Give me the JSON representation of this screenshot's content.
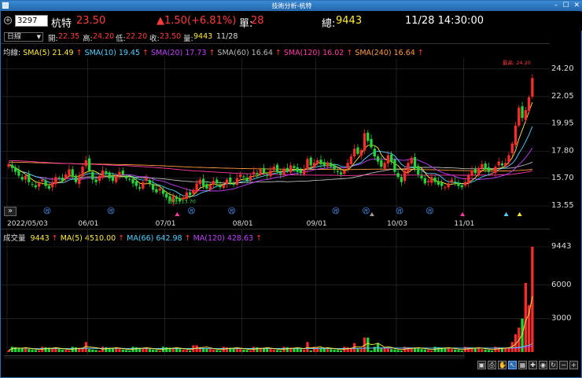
{
  "window": {
    "title": "技術分析-杭特"
  },
  "quote": {
    "code": "3297",
    "name": "杭特",
    "price": "23.50",
    "change": "▲1.50(+6.81%)",
    "single_label": "單:",
    "single_value": "28",
    "total_label": "總:",
    "total_value": "9443",
    "datetime": "11/28 14:30:00"
  },
  "ohlc": {
    "period": "日線",
    "open_label": "開:",
    "open": "22.35",
    "high_label": "高:",
    "high": "24.20",
    "low_label": "低:",
    "low": "22.20",
    "close_label": "收:",
    "close": "23.50",
    "volume_label": "量:",
    "volume": "9443",
    "date": "11/28"
  },
  "price_legend": {
    "prefix": "均線:",
    "items": [
      {
        "text": "SMA(5) 21.49",
        "color": "#ffeb3b"
      },
      {
        "text": "SMA(10) 19.45",
        "color": "#4fd1ff"
      },
      {
        "text": "SMA(20) 17.73",
        "color": "#c040ff"
      },
      {
        "text": "SMA(60) 16.64",
        "color": "#bbbbbb"
      },
      {
        "text": "SMA(120) 16.02",
        "color": "#ff3aa5"
      },
      {
        "text": "SMA(240) 16.64",
        "color": "#ff9a3c"
      }
    ],
    "arrow": "↑"
  },
  "volume_legend": {
    "prefix": "成交量",
    "items": [
      {
        "text": "9443",
        "color": "#ffeb3b"
      },
      {
        "text": "MA(5) 4510.00",
        "color": "#ffeb3b"
      },
      {
        "text": "MA(66) 642.98",
        "color": "#4fd1ff"
      },
      {
        "text": "MA(120) 428.63",
        "color": "#c040ff"
      }
    ],
    "arrow": "↑"
  },
  "chart_data": [
    {
      "type": "candlestick",
      "y_ticks": [
        "24.20",
        "22.05",
        "19.95",
        "17.80",
        "15.70",
        "13.55"
      ],
      "ylim": [
        13.0,
        24.8
      ],
      "x_ticks": [
        "2022/05/03",
        "06/01",
        "07/01",
        "08/01",
        "09/01",
        "10/03",
        "11/01"
      ],
      "high_label": "最高: 24.20",
      "low_label": "最低: 13.70",
      "event_markers": [
        "月",
        "月",
        "月",
        "月",
        "月",
        "月",
        "月",
        "月"
      ],
      "closes": [
        16.8,
        16.5,
        16.2,
        15.9,
        15.6,
        15.9,
        15.4,
        15.2,
        15.0,
        15.3,
        15.6,
        15.1,
        14.9,
        15.4,
        15.8,
        15.7,
        15.5,
        16.0,
        16.4,
        15.8,
        15.4,
        15.9,
        16.6,
        17.1,
        16.3,
        15.6,
        15.4,
        15.9,
        16.3,
        16.1,
        15.7,
        15.5,
        15.9,
        16.2,
        16.0,
        15.7,
        15.6,
        15.3,
        15.1,
        14.9,
        15.4,
        15.7,
        15.3,
        14.8,
        14.6,
        14.9,
        14.5,
        14.2,
        14.0,
        14.3,
        14.1,
        13.9,
        14.2,
        14.6,
        14.4,
        14.8,
        15.3,
        15.6,
        15.1,
        14.9,
        15.2,
        15.5,
        15.3,
        15.0,
        15.2,
        15.6,
        15.4,
        15.2,
        15.7,
        16.0,
        15.8,
        15.5,
        15.9,
        16.2,
        16.0,
        16.4,
        16.1,
        15.9,
        16.3,
        16.6,
        16.2,
        16.0,
        16.4,
        16.3,
        16.7,
        16.5,
        16.2,
        16.1,
        16.4,
        17.2,
        16.7,
        16.9,
        17.1,
        16.8,
        16.7,
        16.9,
        16.6,
        16.4,
        16.2,
        16.0,
        16.3,
        16.9,
        17.4,
        18.0,
        17.6,
        17.9,
        19.2,
        18.6,
        18.1,
        17.4,
        17.0,
        16.6,
        16.9,
        17.5,
        17.0,
        16.2,
        15.8,
        15.4,
        16.3,
        16.9,
        17.3,
        16.5,
        16.0,
        15.7,
        15.3,
        15.5,
        15.8,
        15.4,
        15.2,
        15.1,
        15.0,
        15.3,
        15.6,
        15.4,
        15.1,
        15.0,
        15.4,
        15.9,
        16.3,
        16.1,
        16.5,
        16.8,
        16.4,
        16.2,
        16.1,
        16.6,
        17.0,
        16.7,
        16.9,
        17.5,
        18.4,
        19.8,
        21.2,
        20.4,
        21.0,
        22.0,
        23.5
      ]
    },
    {
      "type": "bar",
      "y_ticks": [
        "9443",
        "6000",
        "3000"
      ],
      "ylim": [
        0,
        9443
      ],
      "last_value": 9443
    }
  ],
  "toolbar": {
    "icons": [
      "save-icon",
      "print-icon",
      "hand-icon",
      "cursor-icon",
      "grid-icon",
      "crosshair-icon",
      "eye-icon",
      "refresh-icon",
      "zoom-out-icon",
      "zoom-in-icon"
    ]
  },
  "colors": {
    "up": "#ff2a2a",
    "down": "#22d63a",
    "axis_text": "#dddddd",
    "price_text": "#ff3b3b",
    "total_text": "#ffeb3b"
  }
}
